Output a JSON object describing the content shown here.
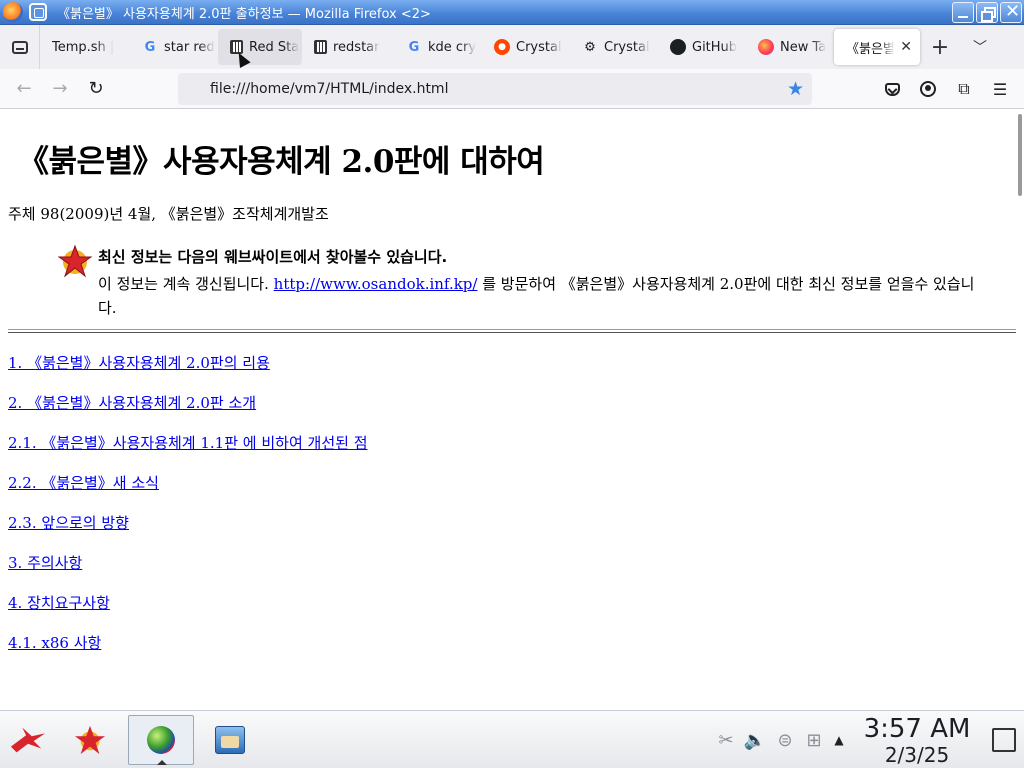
{
  "window": {
    "title": "《붉은별》 사용자용체계 2.0판 출하정보 — Mozilla Firefox <2>"
  },
  "tabs": [
    {
      "label": "Temp.sh |",
      "icon": "none"
    },
    {
      "label": "star red",
      "icon": "google-icon"
    },
    {
      "label": "Red Sta",
      "icon": "redstar-icon"
    },
    {
      "label": "redstar",
      "icon": "redstar-icon"
    },
    {
      "label": "kde cry",
      "icon": "google-icon"
    },
    {
      "label": "Crystal",
      "icon": "reddit-icon"
    },
    {
      "label": "Crystal",
      "icon": "crystal-icon"
    },
    {
      "label": "GitHub",
      "icon": "github-icon"
    },
    {
      "label": "New Ta",
      "icon": "firefox-icon"
    },
    {
      "label": "《붉은별",
      "icon": "none",
      "active": true
    }
  ],
  "navbar": {
    "url": "file:///home/vm7/HTML/index.html"
  },
  "page": {
    "title": "《붉은별》사용자용체계 2.0판에 대하여",
    "byline": "주체 98(2009)년 4월, 《붉은별》조작체계개발조",
    "notice": {
      "heading": "최신 정보는 다음의 웨브싸이트에서 찾아볼수 있습니다.",
      "text_before": "이 정보는 계속 갱신됩니다. ",
      "link": "http://www.osandok.inf.kp/",
      "text_after": " 를 방문하여 《붉은별》사용자용체계 2.0판에 대한 최신 정보를 얻을수 있습니다."
    },
    "toc": [
      "1. 《붉은별》사용자용체계 2.0판의 리용",
      "2. 《붉은별》사용자용체계 2.0판 소개",
      "2.1. 《붉은별》사용자용체계 1.1판 에 비하여 개선된 점",
      "2.2. 《붉은별》새 소식",
      "2.3. 앞으로의 방향",
      "3. 주의사항",
      "4. 장치요구사항",
      "4.1. x86 사항"
    ]
  },
  "taskbar": {
    "time": "3:57 AM",
    "date": "2/3/25"
  },
  "colors": {
    "titlebar": "#4a85d8",
    "link": "#0000ee",
    "bookmark_star": "#3a86e6"
  }
}
